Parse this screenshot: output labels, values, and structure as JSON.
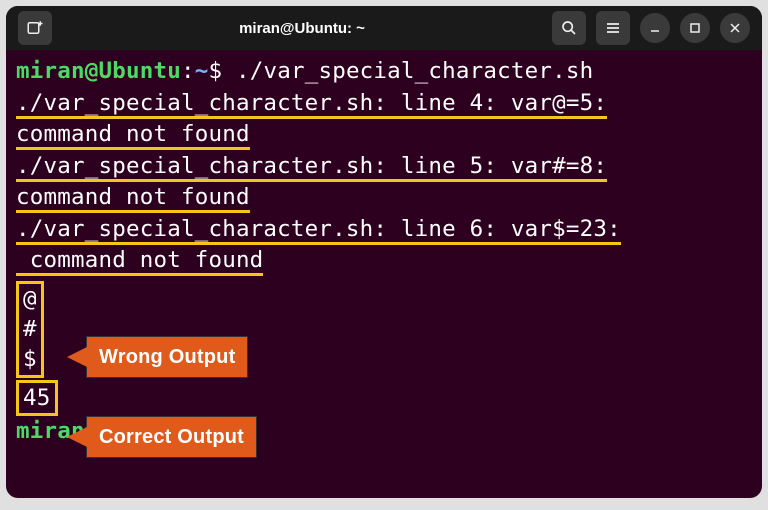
{
  "titlebar": {
    "title": "miran@Ubuntu: ~",
    "new_tab_icon": "new-tab",
    "search_icon": "search",
    "menu_icon": "menu",
    "min_icon": "minimize",
    "max_icon": "maximize",
    "close_icon": "close"
  },
  "prompt": {
    "user": "miran",
    "at": "@",
    "host": "Ubuntu",
    "colon": ":",
    "path": "~",
    "dollar": "$"
  },
  "cmd": {
    "command": "./var_special_character.sh"
  },
  "err1": {
    "text1": "./var_special_character.sh: line 4: var@=5:",
    "text2": "command not found"
  },
  "err2": {
    "text1": "./var_special_character.sh: line 5: var#=8:",
    "text2": "command not found"
  },
  "err3": {
    "text1": "./var_special_character.sh: line 6: var$=23:",
    "text2": " command not found"
  },
  "wrong_output": {
    "l1": "@",
    "l2": "#",
    "l3": "$"
  },
  "correct_output": {
    "l1": "45"
  },
  "tags": {
    "wrong": "Wrong Output",
    "correct": "Correct Output"
  }
}
